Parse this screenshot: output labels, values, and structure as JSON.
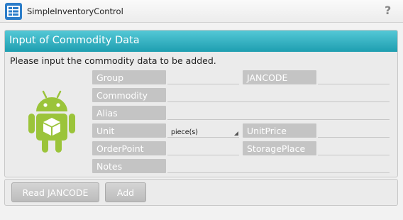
{
  "app": {
    "title": "SimpleInventoryControl",
    "icon": "inventory-app-icon",
    "help_icon": "?"
  },
  "panel": {
    "title": "Input of Commodity Data",
    "instructions": "Please input the commodity data to be added.",
    "illustration": "android-robot-box-icon"
  },
  "form": {
    "group_label": "Group",
    "jancode_label": "JANCODE",
    "commodity_label": "Commodity",
    "alias_label": "Alias",
    "unit_label": "Unit",
    "unit_value": "piece(s)",
    "unitprice_label": "UnitPrice",
    "orderpoint_label": "OrderPoint",
    "storageplace_label": "StoragePlace",
    "notes_label": "Notes"
  },
  "buttons": {
    "read_jancode": "Read JANCODE",
    "add": "Add"
  },
  "colors": {
    "header": "#33b5c5",
    "label_bg": "#c4c4c4",
    "android_green": "#9bc43a"
  }
}
